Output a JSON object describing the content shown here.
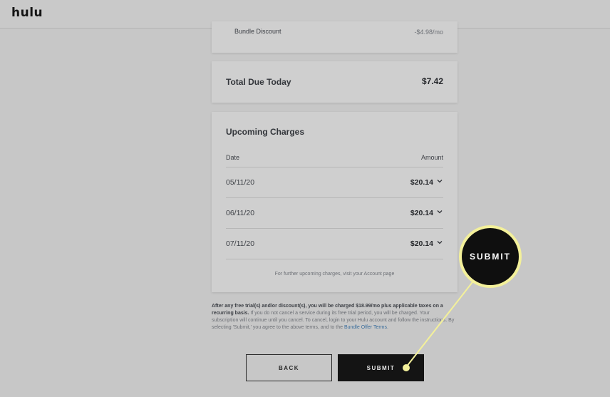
{
  "header": {
    "logo": "hulu"
  },
  "summary": {
    "discount_label": "Bundle Discount",
    "discount_amount": "-$4.98/mo",
    "total_label": "Total Due Today",
    "total_amount": "$7.42"
  },
  "upcoming": {
    "title": "Upcoming Charges",
    "col_date": "Date",
    "col_amount": "Amount",
    "rows": [
      {
        "date": "05/11/20",
        "amount": "$20.14"
      },
      {
        "date": "06/11/20",
        "amount": "$20.14"
      },
      {
        "date": "07/11/20",
        "amount": "$20.14"
      }
    ],
    "footnote": "For further upcoming charges, visit your Account page"
  },
  "legal": {
    "bold": "After any free trial(s) and/or discount(s), you will be charged $18.99/mo plus applicable taxes on a recurring basis.",
    "body": " If you do not cancel a service during its free trial period, you will be charged. Your subscription will continue until you cancel. To cancel, login to your Hulu account and follow the instructions. By selecting 'Submit,' you agree to the above terms, and to the ",
    "link": "Bundle Offer Terms",
    "end": "."
  },
  "buttons": {
    "back": "BACK",
    "submit": "SUBMIT"
  },
  "callout": {
    "label": "SUBMIT",
    "color": "#f3f09a"
  },
  "icons": {
    "chevron": "chevron-down-icon"
  }
}
